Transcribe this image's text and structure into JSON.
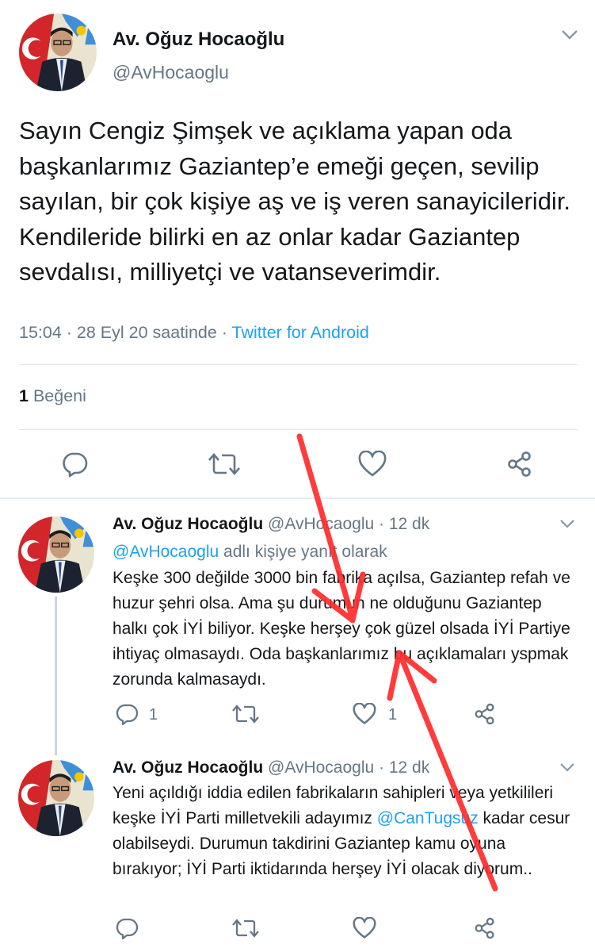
{
  "main_tweet": {
    "author_name": "Av. Oğuz Hocaoğlu",
    "handle": "@AvHocaoglu",
    "text": "Sayın Cengiz Şimşek ve açıklama yapan oda başkanlarımız Gaziantep’e emeği geçen, sevilip sayılan, bir çok kişiye aş ve iş veren sanayicileridir. Kendileride bilirki en az onlar kadar Gaziantep sevdalısı, milliyetçi ve vatanseverimdir.",
    "timestamp": "15:04 · 28 Eyl 20 saatinde · ",
    "source": "Twitter for Android",
    "like_count": "1",
    "like_label": " Beğeni"
  },
  "replies": [
    {
      "author_name": "Av. Oğuz Hocaoğlu",
      "handle_time": " @AvHocaoglu · 12 dk",
      "reply_to_handle": "@AvHocaoglu",
      "reply_to_suffix": " adlı kişiye yanıt olarak",
      "text": "Keşke 300 değilde 3000 bin fabrika açılsa, Gaziantep refah ve huzur şehri olsa. Ama şu durumun ne olduğunu Gaziantep halkı çok İYİ biliyor. Keşke herşey çok güzel olsada İYİ Partiye ihtiyaç olmasaydı. Oda başkanlarımız bu açıklamaları yspmak zorunda kalmasaydı.",
      "reply_count": "1",
      "like_count": "1"
    },
    {
      "author_name": "Av. Oğuz Hocaoğlu",
      "handle_time": " @AvHocaoglu · 12 dk",
      "text_part1": "Yeni açıldığı iddia edilen fabrikaların sahipleri veya yetkilileri keşke İYİ Parti milletvekili adayımız ",
      "mention": "@CanTugsuz",
      "text_part2": " kadar cesur olabilseydi. Durumun takdirini Gaziantep kamu oyuna bırakıyor; İYİ Parti iktidarında herşey İYİ olacak diyorum.."
    }
  ],
  "icons": {
    "reply": "reply-icon",
    "retweet": "retweet-icon",
    "like": "heart-icon",
    "share": "share-icon",
    "more": "chevron-down-icon"
  },
  "colors": {
    "accent": "#1da1f2",
    "secondary_text": "#657786",
    "annotation_arrow": "#ff2b2b"
  }
}
